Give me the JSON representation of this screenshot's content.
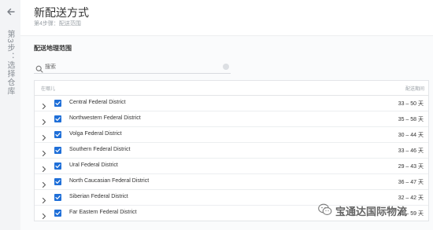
{
  "rail": {
    "back_icon": "back-arrow-icon",
    "vertical_text": "第3步：选择仓库"
  },
  "header": {
    "title": "新配送方式",
    "step": "第4步骤：配送范围"
  },
  "section": {
    "title": "配送地理范围"
  },
  "search": {
    "placeholder": "搜索",
    "value": ""
  },
  "table": {
    "col_region": "在哪儿",
    "col_days": "配送期间",
    "rows": [
      {
        "name": "Central Federal District",
        "days": "33 – 50 天",
        "checked": true
      },
      {
        "name": "Northwestern Federal District",
        "days": "35 – 58 天",
        "checked": true
      },
      {
        "name": "Volga Federal District",
        "days": "30 – 44 天",
        "checked": true
      },
      {
        "name": "Southern Federal District",
        "days": "33 – 46 天",
        "checked": true
      },
      {
        "name": "Ural Federal District",
        "days": "29 – 43 天",
        "checked": true
      },
      {
        "name": "North Caucasian Federal District",
        "days": "36 – 47 天",
        "checked": true
      },
      {
        "name": "Siberian Federal District",
        "days": "32 – 42 天",
        "checked": true
      },
      {
        "name": "Far Eastern Federal District",
        "days": "41 – 59 天",
        "checked": true
      }
    ]
  },
  "watermark": {
    "text": "宝通达国际物流",
    "icon": "wechat-icon"
  },
  "colors": {
    "accent": "#1f6fd8",
    "border": "#e3e5e8"
  }
}
